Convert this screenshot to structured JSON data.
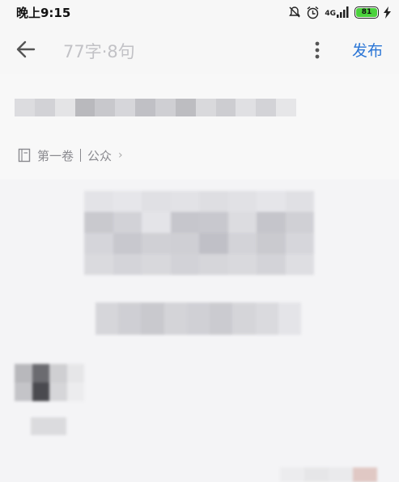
{
  "status_bar": {
    "time": "晚上9:15",
    "network_label": "4G",
    "battery_level": "81",
    "icons": [
      "mute-bell-icon",
      "alarm-icon",
      "signal-icon",
      "battery-icon",
      "charging-icon"
    ]
  },
  "app_bar": {
    "word_sentence_count": "77字·8句",
    "publish_label": "发布",
    "icons": [
      "back-arrow-icon",
      "more-vert-icon"
    ]
  },
  "chapter": {
    "volume": "第一卷",
    "visibility": "公众",
    "icons": [
      "book-icon",
      "chevron-right-icon"
    ]
  },
  "colors": {
    "accent": "#2b76d6",
    "background": "#f4f4f6",
    "muted_text": "#c2c2c6"
  }
}
